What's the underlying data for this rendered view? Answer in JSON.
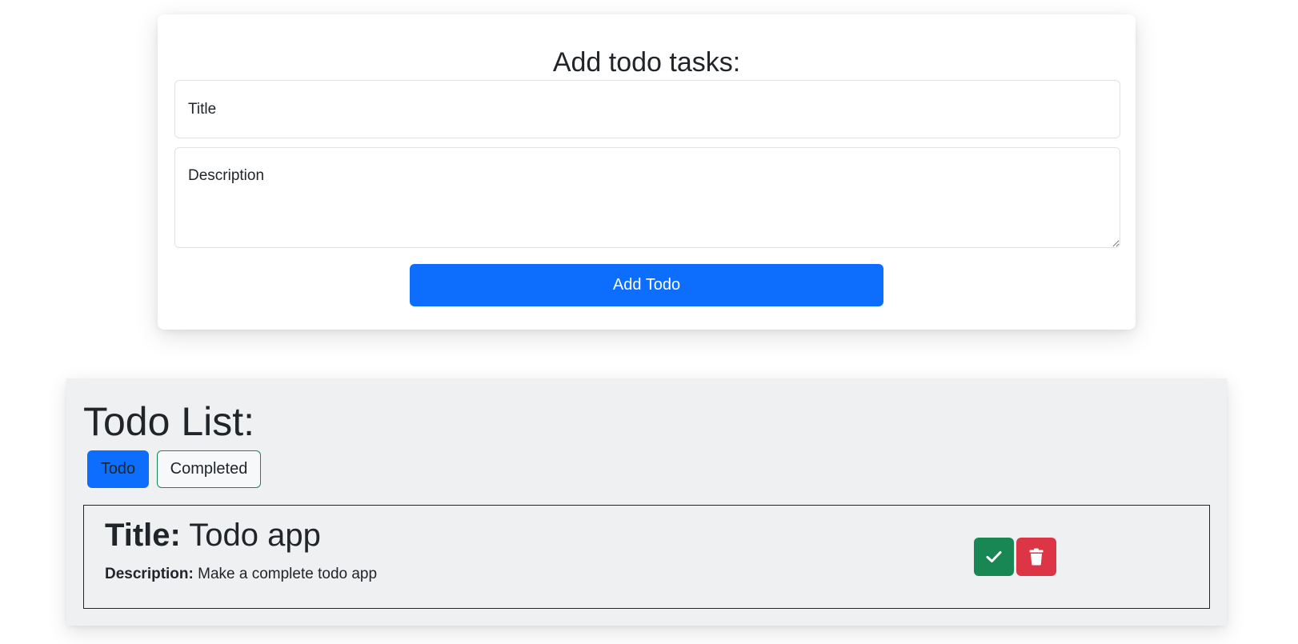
{
  "add_form": {
    "heading": "Add todo tasks:",
    "title_placeholder": "Title",
    "description_placeholder": "Description",
    "submit_label": "Add Todo"
  },
  "todo_list": {
    "heading": "Todo List:",
    "tabs": [
      {
        "label": "Todo",
        "active": true
      },
      {
        "label": "Completed",
        "active": false
      }
    ],
    "items": [
      {
        "title_label": "Title:",
        "title": "Todo app",
        "description_label": "Description:",
        "description": "Make a complete todo app",
        "actions": [
          {
            "icon": "check-icon",
            "color": "#198754"
          },
          {
            "icon": "trash-icon",
            "color": "#dc3545"
          }
        ]
      }
    ]
  },
  "colors": {
    "primary": "#0d6efd",
    "success": "#198754",
    "danger": "#dc3545",
    "panel_background": "#eff0f2"
  }
}
